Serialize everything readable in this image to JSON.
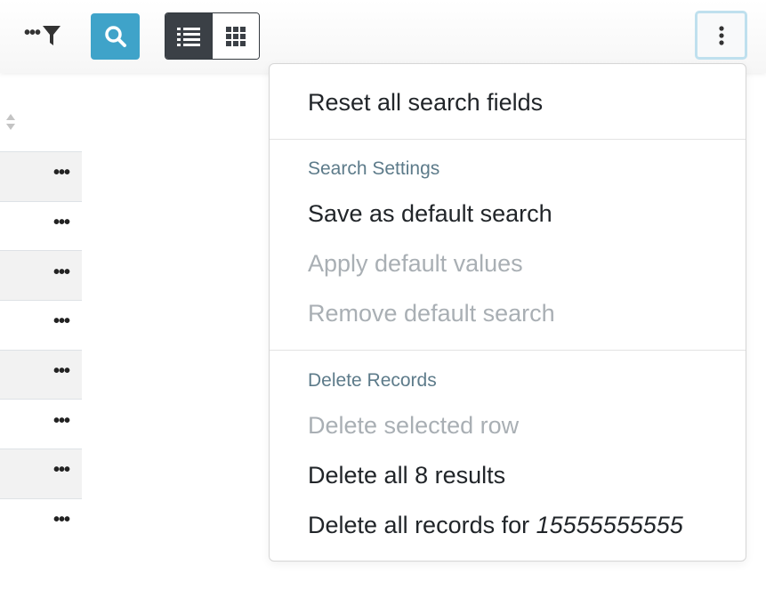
{
  "toolbar": {
    "filter_dots": "•••",
    "icons": {
      "filter": "funnel-icon",
      "search": "search-icon",
      "list_view": "list-view-icon",
      "grid_view": "grid-view-icon",
      "more": "vertical-ellipsis-icon"
    },
    "colors": {
      "search_button_bg": "#3fa3c9",
      "active_view_bg": "#3b4046",
      "more_button_focus": "#bfe0ee"
    }
  },
  "table": {
    "row_action_label": "•••",
    "rows": 8
  },
  "menu": {
    "reset_label": "Reset all search fields",
    "search_settings_header": "Search Settings",
    "save_default_label": "Save as default search",
    "apply_default_label": "Apply default values",
    "remove_default_label": "Remove default search",
    "delete_records_header": "Delete Records",
    "delete_selected_label": "Delete selected row",
    "delete_all_results_label": "Delete all 8 results",
    "delete_all_records_prefix": "Delete all records for ",
    "delete_all_records_value": "15555555555"
  }
}
